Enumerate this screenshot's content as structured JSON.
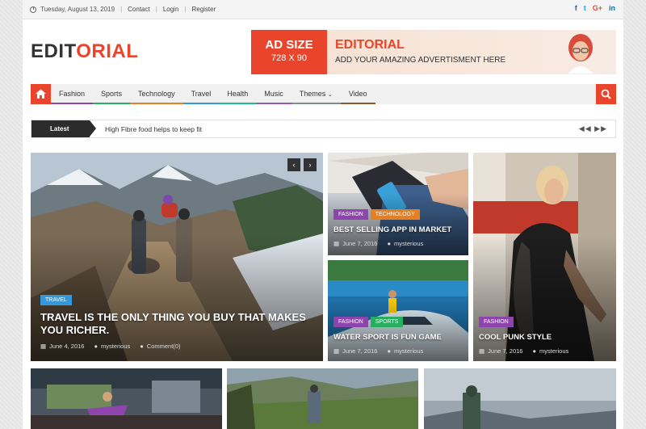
{
  "topbar": {
    "date": "Tuesday, August 13, 2019",
    "links": [
      "Contact",
      "Login",
      "Register"
    ],
    "social": [
      "f",
      "t",
      "G+",
      "in"
    ]
  },
  "logo": {
    "part1": "EDIT",
    "part2": "ORIAL"
  },
  "ad": {
    "size_label": "AD SIZE",
    "size_value": "728 X 90",
    "brand": "EDITORIAL",
    "tagline": "ADD YOUR AMAZING ADVERTISMENT HERE"
  },
  "nav": {
    "items": [
      {
        "label": "Fashion",
        "color": "#8e44ad"
      },
      {
        "label": "Sports",
        "color": "#27ae60"
      },
      {
        "label": "Technology",
        "color": "#e67e22"
      },
      {
        "label": "Travel",
        "color": "#3498db"
      },
      {
        "label": "Health",
        "color": "#1abc9c"
      },
      {
        "label": "Music",
        "color": "#9b59b6"
      },
      {
        "label": "Themes",
        "color": "#7f8c8d"
      },
      {
        "label": "Video",
        "color": "#8b5a2b"
      }
    ]
  },
  "ticker": {
    "label": "Latest",
    "text": "High Fibre food helps to keep fit"
  },
  "featured": {
    "tag": "TRAVEL",
    "title": "TRAVEL IS THE ONLY THING YOU BUY THAT MAKES YOU RICHER.",
    "date": "June 4, 2016",
    "author": "mysterious",
    "comments": "Comment(0)"
  },
  "card_app": {
    "tags": [
      "FASHION",
      "TECHNOLOGY"
    ],
    "title": "BEST SELLING APP IN MARKET",
    "date": "June 7, 2016",
    "author": "mysterious"
  },
  "card_water": {
    "tags": [
      "FASHION",
      "SPORTS"
    ],
    "title": "WATER SPORT IS FUN GAME",
    "date": "June 7, 2016",
    "author": "mysterious"
  },
  "card_punk": {
    "tags": [
      "FASHION"
    ],
    "title": "COOL PUNK STYLE",
    "date": "June 7, 2016",
    "author": "mysterious"
  },
  "colors": {
    "accent": "#e8452c",
    "tag_fashion": "#8e44ad",
    "tag_tech": "#e67e22",
    "tag_sports": "#27ae60",
    "tag_travel": "#3498db"
  }
}
